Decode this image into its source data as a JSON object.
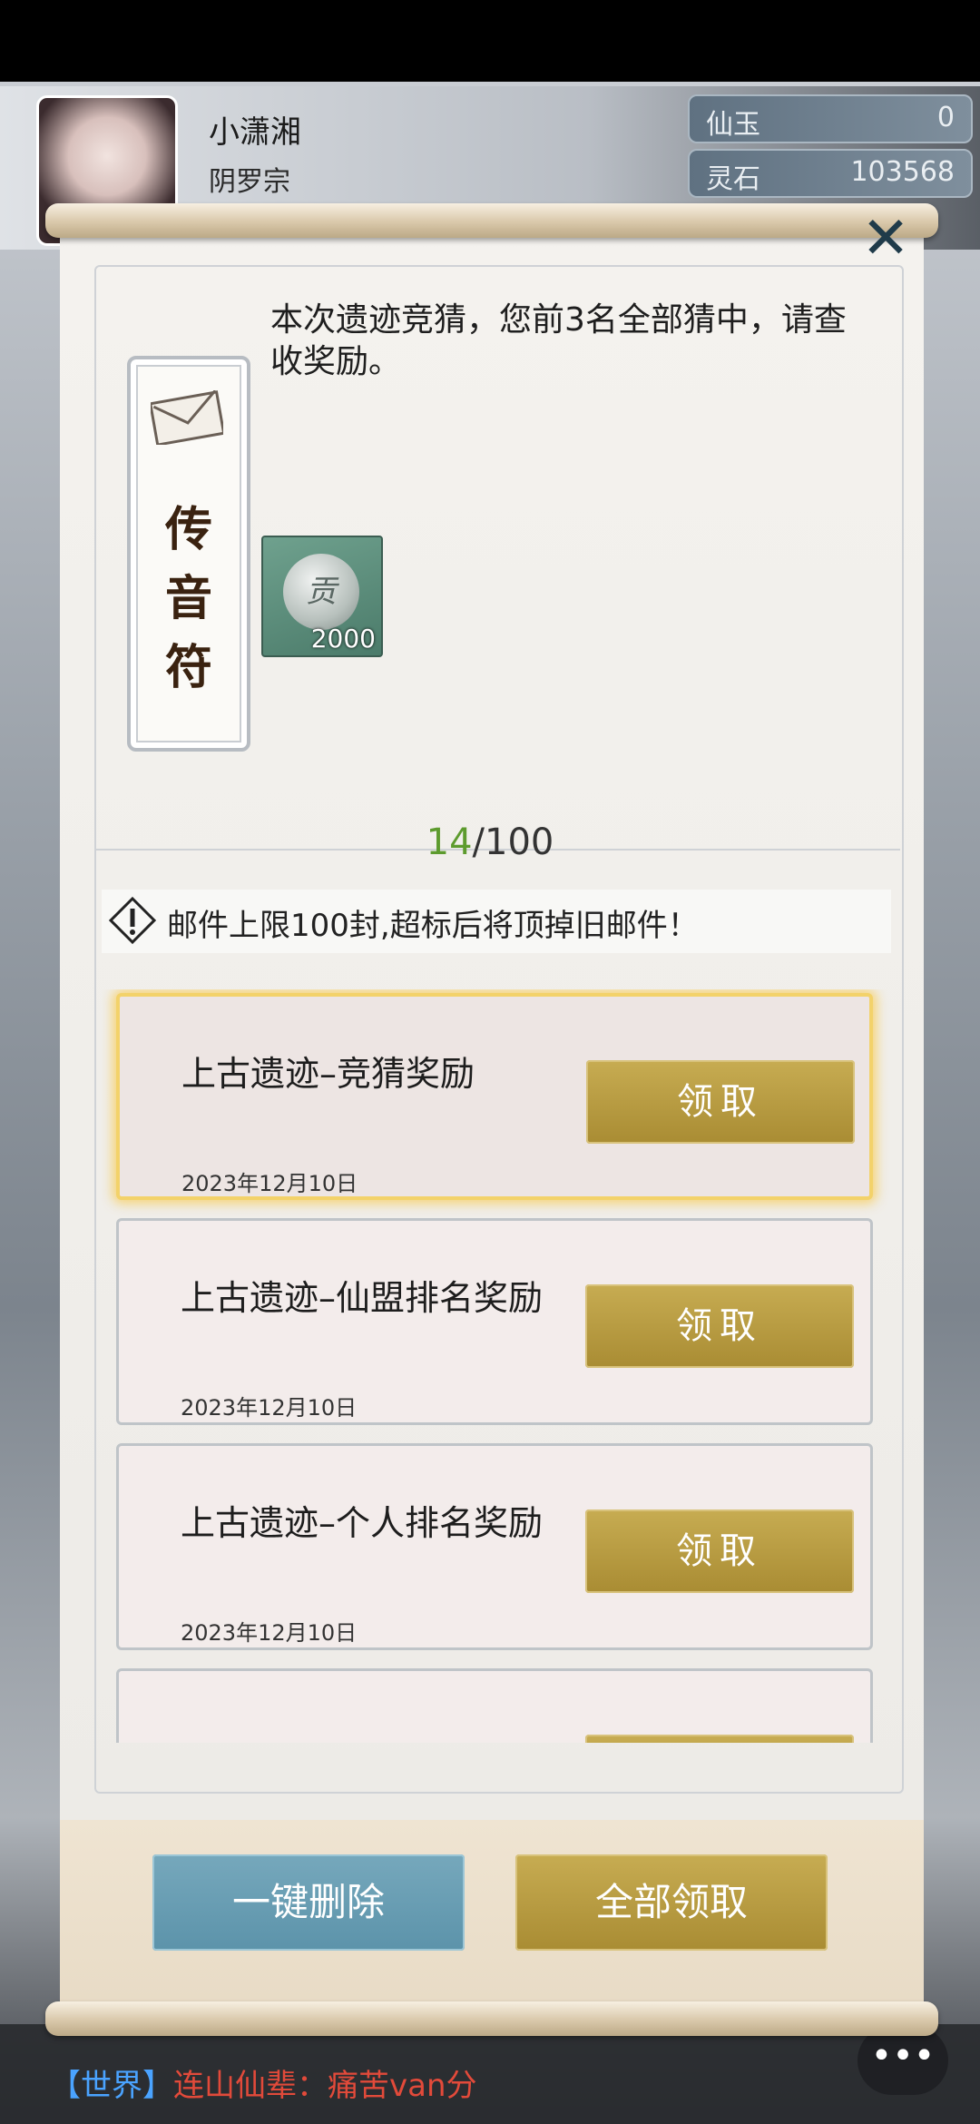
{
  "player": {
    "name": "小潇湘",
    "sect": "阴罗宗"
  },
  "resources": [
    {
      "label": "仙玉",
      "value": "0"
    },
    {
      "label": "灵石",
      "value": "103568"
    }
  ],
  "mail_detail": {
    "tag_title": "传\n音\n符",
    "message": "本次遗迹竞猜，您前3名全部猜中，请查收奖励。",
    "reward_icon_char": "贡",
    "reward_count": "2000"
  },
  "counter": {
    "current": "14",
    "total": "/100"
  },
  "notice": "邮件上限100封,超标后将顶掉旧邮件！",
  "mails": [
    {
      "title": "上古遗迹–竞猜奖励",
      "date": "2023年12月10日",
      "button": "领取"
    },
    {
      "title": "上古遗迹–仙盟排名奖励",
      "date": "2023年12月10日",
      "button": "领取"
    },
    {
      "title": "上古遗迹–个人排名奖励",
      "date": "2023年12月10日",
      "button": "领取"
    }
  ],
  "buttons": {
    "delete_all": "一键删除",
    "claim_all": "全部领取"
  },
  "chat": {
    "channel": "【世界】",
    "speaker": "连山仙辈：",
    "message": "痛苦van分"
  },
  "icons": {
    "close": "close-icon",
    "envelope": "envelope-icon",
    "warning": "warning-icon",
    "chat": "chat-bubble-icon"
  }
}
